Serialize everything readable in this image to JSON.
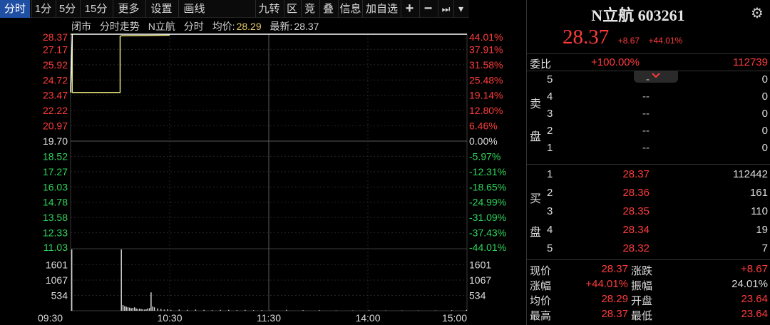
{
  "toolbar": {
    "left": [
      {
        "label": "分时",
        "selected": true
      },
      {
        "label": "1分"
      },
      {
        "label": "5分"
      },
      {
        "label": "15分"
      },
      {
        "label": "更多"
      },
      {
        "label": "设置"
      },
      {
        "label": "画线"
      }
    ],
    "right": [
      {
        "label": "九转"
      },
      {
        "label": "区"
      },
      {
        "label": "竞"
      },
      {
        "label": "叠"
      },
      {
        "label": "信息"
      },
      {
        "label": "加自选"
      }
    ],
    "icons": {
      "plus": "+",
      "minus": "−",
      "next": "⏭",
      "menu": "▾"
    }
  },
  "chart_info": {
    "status": "闭市",
    "title": "分时走势",
    "name": "N立航",
    "mode": "分时",
    "avg_label": "均价:",
    "avg_value": "28.29",
    "last_label": "最新:",
    "last_value": "28.37"
  },
  "chart_data": {
    "type": "line",
    "prev_close": 19.7,
    "price_axis": {
      "ticks": [
        "28.37",
        "27.17",
        "25.92",
        "24.72",
        "23.47",
        "22.22",
        "20.97",
        "19.70",
        "18.52",
        "17.27",
        "16.03",
        "14.78",
        "13.58",
        "12.33",
        "11.03"
      ],
      "pct_ticks": [
        "44.01%",
        "37.91%",
        "31.58%",
        "25.48%",
        "19.14%",
        "12.80%",
        "6.46%",
        "0.00%",
        "-5.97%",
        "-12.31%",
        "-18.65%",
        "-24.99%",
        "-31.09%",
        "-37.43%",
        "-44.01%"
      ],
      "ylim": [
        11.03,
        28.37
      ]
    },
    "volume_axis": {
      "ticks": [
        "1601",
        "1067",
        "534"
      ],
      "ylim": [
        0,
        2135
      ]
    },
    "x_ticks": [
      "09:30",
      "10:30",
      "11:30",
      "14:00",
      "15:00"
    ],
    "x_range_minutes": [
      0,
      240
    ],
    "price_series": {
      "name": "price",
      "color": "#ffffff",
      "x": [
        0,
        1,
        1,
        240
      ],
      "y": [
        23.64,
        28.37,
        28.37,
        28.37
      ]
    },
    "avg_series": {
      "name": "avg",
      "color": "#e5e27a",
      "x": [
        0,
        1,
        1,
        30,
        30,
        31,
        60
      ],
      "y": [
        28.37,
        28.37,
        23.64,
        23.64,
        28.2,
        28.25,
        28.29
      ]
    },
    "volume": {
      "x": [
        0,
        30,
        31,
        32,
        33,
        34,
        35,
        36,
        37,
        38,
        39,
        40,
        41,
        42,
        43,
        44,
        45,
        46,
        47,
        48,
        49,
        50,
        52,
        54,
        56,
        58,
        60,
        65,
        70,
        75,
        80,
        85,
        90,
        95,
        100,
        105,
        110,
        115,
        120,
        130,
        140,
        150,
        160,
        170,
        180,
        190,
        200,
        210,
        220,
        230,
        239
      ],
      "values": [
        2135,
        2135,
        200,
        160,
        140,
        120,
        110,
        90,
        100,
        120,
        80,
        60,
        70,
        60,
        50,
        40,
        50,
        80,
        90,
        640,
        150,
        120,
        80,
        60,
        40,
        50,
        30,
        40,
        30,
        40,
        30,
        20,
        30,
        30,
        20,
        30,
        20,
        20,
        10,
        30,
        20,
        20,
        10,
        10,
        20,
        10,
        10,
        10,
        10,
        20,
        30
      ]
    }
  },
  "panel": {
    "title": "N立航 603261",
    "gear_icon": "gear-icon",
    "price": "28.37",
    "change": "+8.67",
    "change_pct": "+44.01%",
    "ratio_label": "委比",
    "ratio_value": "+100.00%",
    "ratio_num": "112739",
    "sell_label": [
      "卖",
      "盘"
    ],
    "buy_label": [
      "买",
      "盘"
    ],
    "asks": [
      {
        "level": "5",
        "price": "-",
        "vol": "0"
      },
      {
        "level": "4",
        "price": "--",
        "vol": "0"
      },
      {
        "level": "3",
        "price": "--",
        "vol": "0"
      },
      {
        "level": "2",
        "price": "--",
        "vol": "0"
      },
      {
        "level": "1",
        "price": "--",
        "vol": "0"
      }
    ],
    "bids": [
      {
        "level": "1",
        "price": "28.37",
        "vol": "112442"
      },
      {
        "level": "2",
        "price": "28.36",
        "vol": "161"
      },
      {
        "level": "3",
        "price": "28.35",
        "vol": "110"
      },
      {
        "level": "4",
        "price": "28.34",
        "vol": "19"
      },
      {
        "level": "5",
        "price": "28.32",
        "vol": "7"
      }
    ],
    "stats": [
      {
        "l1": "现价",
        "v1": "28.37",
        "l2": "涨跌",
        "v2": "+8.67"
      },
      {
        "l1": "涨幅",
        "v1": "+44.01%",
        "l2": "振幅",
        "v2": "24.01%"
      },
      {
        "l1": "均价",
        "v1": "28.29",
        "l2": "开盘",
        "v2": "23.64"
      },
      {
        "l1": "最高",
        "v1": "28.37",
        "l2": "最低",
        "v2": "23.64"
      }
    ]
  },
  "colors": {
    "up": "#ff3b3b",
    "down": "#2fd65a",
    "flat": "#dddddd",
    "avg": "#e5e27a",
    "selected_tab": "#1f4fa3"
  }
}
